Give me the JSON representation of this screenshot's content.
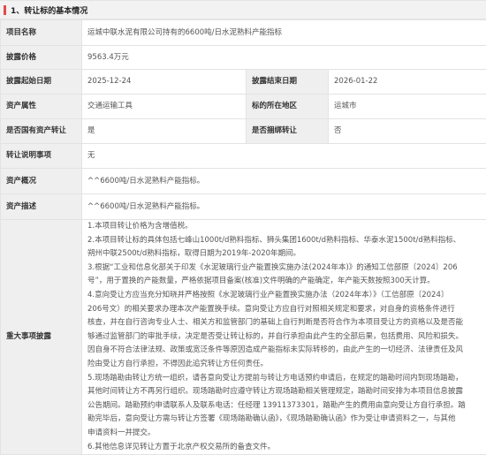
{
  "section": {
    "title": "1、转让标的基本情况",
    "accent_color": "#e34a4a",
    "marker_icon": "red-bar-marker"
  },
  "rows": {
    "project_name": {
      "label": "项目名称",
      "value": "运城中联水泥有限公司持有的6600吨/日水泥熟料产能指标"
    },
    "price": {
      "label": "披露价格",
      "value": "9563.4万元"
    },
    "dates": {
      "start_label": "披露起始日期",
      "start_value": "2025-12-24",
      "end_label": "披露结束日期",
      "end_value": "2026-01-22"
    },
    "asset": {
      "attr_label": "资产属性",
      "attr_value": "交通运输工具",
      "location_label": "标的所在地区",
      "location_value": "运城市"
    },
    "state_owned": {
      "state_label": "是否国有资产转让",
      "state_value": "是",
      "bundle_label": "是否捆绑转让",
      "bundle_value": "否"
    },
    "explanation": {
      "label": "转让说明事项",
      "value": "无"
    },
    "overview": {
      "label": "资产概况",
      "value": "^^6600吨/日水泥熟料产能指标。"
    },
    "description": {
      "label": "资产描述",
      "value": "^^6600吨/日水泥熟料产能指标。"
    },
    "disclosures": {
      "label": "重大事项披露",
      "lines": [
        "1.本项目转让价格为含增值税。",
        "2.本项目转让标的具体包括七峰山1000t/d熟料指标、狮头集团1600t/d熟料指标、华泰水泥1500t/d熟料指标、",
        "朔州中联2500t/d熟料指标，取得日期为2019年-2020年期间。",
        "3.根据“工业和信息化部关于印发《水泥玻璃行业产能置换实施办法(2024年本)》的通知工信部原〔2024〕206",
        "号”，用于置换的产能数量，严格依据项目备案(核准)文件明确的产能确定，年产能天数按照300天计算。",
        "4.意向受让方应当充分知晓并严格按照《水泥玻璃行业产能置换实施办法（2024年本）》（工信部原〔2024〕",
        "206号文）的相关要求办理本次产能置换手续。意向受让方应自行对照相关规定和要求，对自身的资格条件进行",
        "核查，并在自行咨询专业人士、相关方和监管部门的基础上自行判断是否符合作为本项目受让方的资格以及是否能",
        "够通过监管部门的审批手续，决定是否受让转让标的，并自行承担由此产生的全部后果，包括费用、风险和损失。",
        "因自身不符合法律法规、政策或宽泛条件等原因造成产能指标未实际转移的，由此产生的一切经济、法律责任及风",
        "险由受让方自行承担，不得因此追究转让方任何责任。",
        "5.现场踏勘由转让方统一组织，请各意向受让方提前与转让方电话预约申请后，在规定的踏勘时间内到现场踏勘，",
        "其他时间转让方不再另行组织。现场踏勘时应遵守转让方现场踏勘相关管理规定，踏勘时间安排为本项目信息披露",
        "公告期间。踏勘预约申请联系人及联系电话：任经理 13911373301，踏勘产生的费用由意向受让方自行承担。踏",
        "勘完毕后，意向受让方需与转让方签署《现场踏勘确认函》，《现场踏勘确认函》作为受让申请资料之一，与其他",
        "申请资料一并提交。",
        "6.其他信息详见转让方置于北京产权交易所的备查文件。"
      ]
    }
  }
}
